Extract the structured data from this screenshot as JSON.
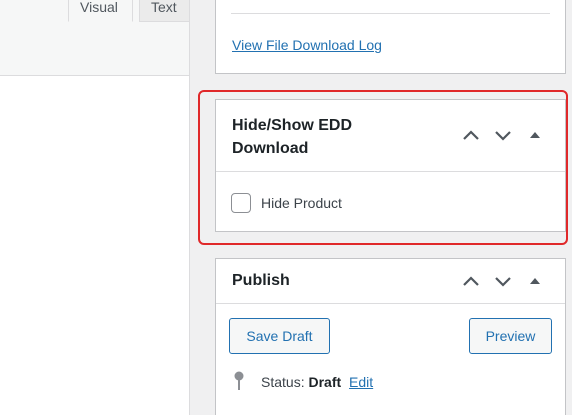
{
  "editor": {
    "tabs": [
      {
        "label": "Visual"
      },
      {
        "label": "Text"
      }
    ]
  },
  "download_box": {
    "link_label": "View File Download Log"
  },
  "hide_box": {
    "title": "Hide/Show EDD Download",
    "checkbox_label": "Hide Product",
    "checked": false
  },
  "publish_box": {
    "title": "Publish",
    "save_label": "Save Draft",
    "preview_label": "Preview",
    "status_prefix": "Status:",
    "status_value": "Draft",
    "status_edit": "Edit"
  },
  "icons": {
    "move_up": "chevron-up-icon",
    "move_down": "chevron-down-icon",
    "toggle": "triangle-up-icon",
    "status": "pin-icon"
  },
  "colors": {
    "link": "#2271b1",
    "highlight": "#e0282a"
  }
}
